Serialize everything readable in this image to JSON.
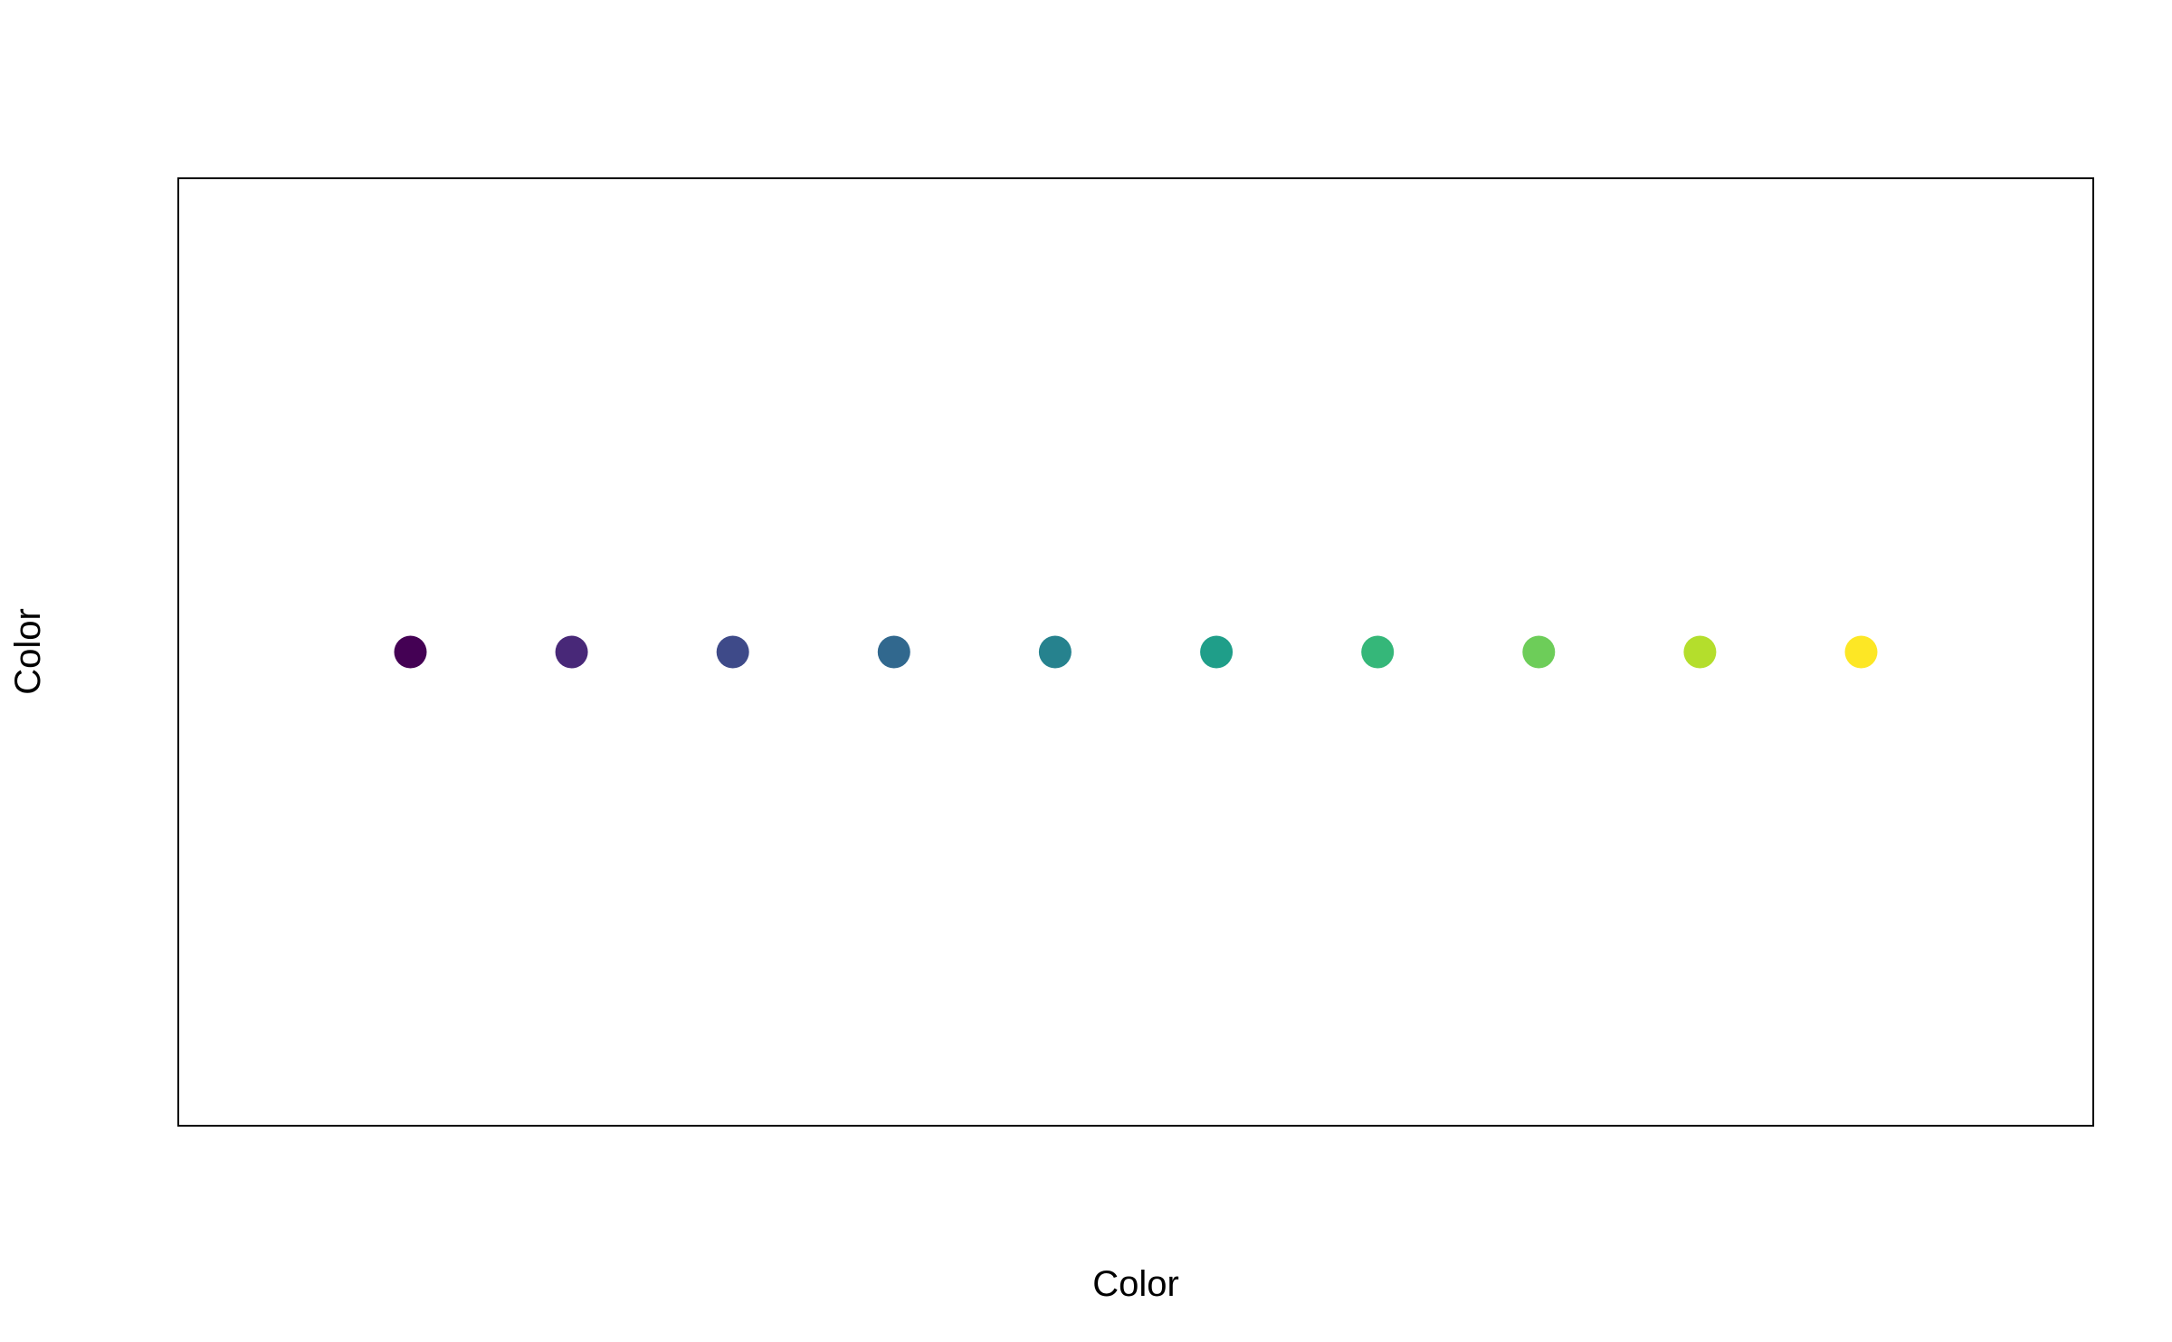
{
  "chart_data": {
    "type": "scatter",
    "title": "",
    "xlabel": "Color",
    "ylabel": "Color",
    "x": [
      1,
      2,
      3,
      4,
      5,
      6,
      7,
      8,
      9,
      10
    ],
    "y": [
      1,
      1,
      1,
      1,
      1,
      1,
      1,
      1,
      1,
      1
    ],
    "colors": [
      "#440154",
      "#482878",
      "#3E4A89",
      "#31688E",
      "#26828E",
      "#1F9E89",
      "#35B779",
      "#6DCD59",
      "#B4DE2C",
      "#FDE725"
    ],
    "xlim": [
      -0.44,
      11.44
    ],
    "ylim": [
      0.6,
      1.4
    ],
    "grid": false,
    "axes_ticks": false,
    "legend": "none"
  }
}
